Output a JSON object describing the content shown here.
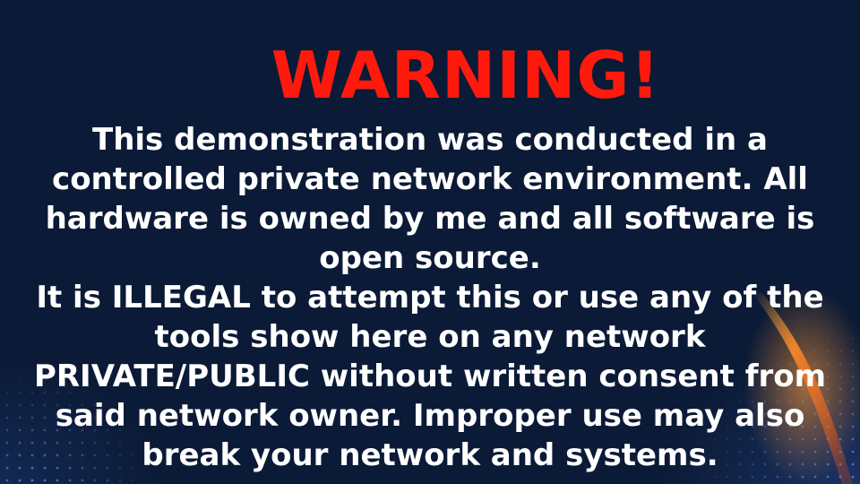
{
  "warning": {
    "title": "WARNING!",
    "lines": [
      "This demonstration was conducted in a",
      "controlled private network environment. All",
      "hardware is owned by me and all software is",
      "open source.",
      "It is ILLEGAL to attempt this or use any of the",
      "tools show here on any network",
      "PRIVATE/PUBLIC without written consent from",
      "said network owner. Improper use may also",
      "break your network and systems."
    ]
  },
  "colors": {
    "background": "#0b1a36",
    "title": "#ff1a0d",
    "text": "#ffffff",
    "streak": "#ff7a1a"
  }
}
